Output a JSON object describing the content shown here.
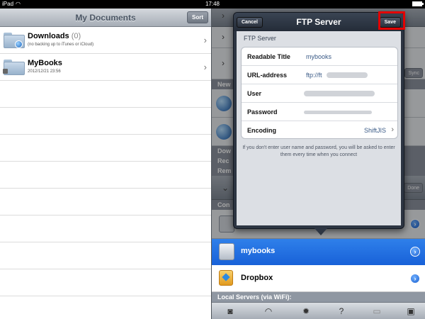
{
  "status_bar": {
    "device": "iPad",
    "time": "17:48"
  },
  "left_pane": {
    "title": "My Documents",
    "sort_label": "Sort",
    "items": [
      {
        "name": "Downloads",
        "count": "(0)",
        "subtitle": "(no backing up to iTunes or iCloud)"
      },
      {
        "name": "MyBooks",
        "subtitle": "2012/12/21 23:56"
      }
    ]
  },
  "right_pane": {
    "sections": {
      "new": "New",
      "down": "Dow",
      "rec": "Rec",
      "rem": "Rem",
      "con": "Con"
    },
    "sync_label": "Sync",
    "done_label": "Done",
    "selected_item": "mybooks",
    "dropbox_item": "Dropbox",
    "local_servers": "Local Servers (via WiFi):"
  },
  "popover": {
    "title": "FTP Server",
    "cancel_label": "Cancel",
    "save_label": "Save",
    "group_title": "FTP Server",
    "rows": [
      {
        "label": "Readable Title",
        "value": "mybooks"
      },
      {
        "label": "URL-address",
        "value": "ftp://ft"
      },
      {
        "label": "User",
        "value": ""
      },
      {
        "label": "Password",
        "value": ""
      },
      {
        "label": "Encoding",
        "value": "ShiftJIS"
      }
    ],
    "hint": "If you don't enter user name and password, you will be asked to enter them every time when you connect"
  },
  "colors": {
    "selected_row": "#1861d8",
    "highlight_box": "#e30000",
    "popover_bg": "#2d3542"
  }
}
